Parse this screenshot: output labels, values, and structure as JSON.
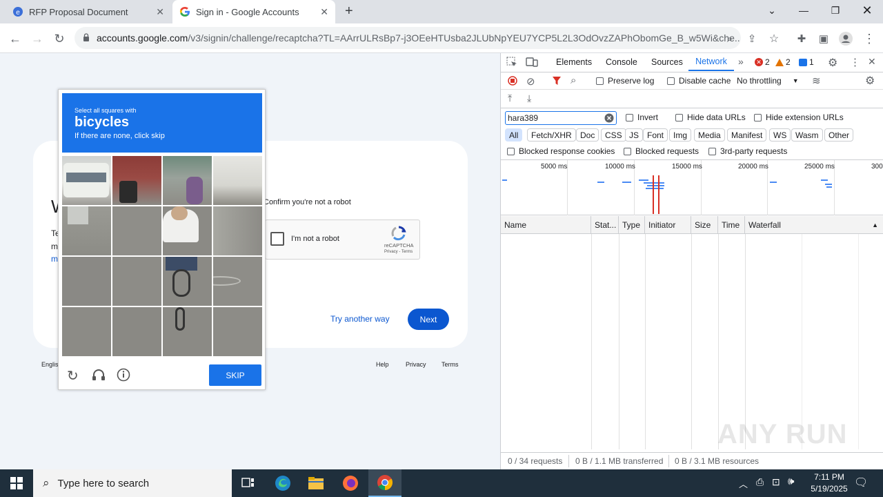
{
  "browser": {
    "tabs": [
      {
        "title": "RFP Proposal Document",
        "icon": "edge-doc-icon"
      },
      {
        "title": "Sign in - Google Accounts",
        "icon": "google-g-icon"
      }
    ],
    "url_host": "accounts.google.com",
    "url_path": "/v3/signin/challenge/recaptcha?TL=AArrULRsBp7-j3OEeHTUsba2JLUbNpYEU7YCP5L2L3OdOvzZAPhObomGe_B_w5Wi&che..."
  },
  "page": {
    "confirm_text": "Confirm you're not a robot",
    "recaptcha_label": "I'm not a robot",
    "recaptcha_brand": "reCAPTCHA",
    "recaptcha_links": "Privacy - Terms",
    "try_another": "Try another way",
    "next_label": "Next",
    "footer_lang": "Englis",
    "footer_help": "Help",
    "footer_privacy": "Privacy",
    "footer_terms": "Terms",
    "partial_letters": [
      "W",
      "Te",
      "m",
      "m"
    ]
  },
  "captcha": {
    "instruction_top": "Select all squares with",
    "target": "bicycles",
    "instruction_bottom": "If there are none, click skip",
    "skip_label": "SKIP"
  },
  "devtools": {
    "tabs": [
      "Elements",
      "Console",
      "Sources",
      "Network"
    ],
    "active_tab": "Network",
    "error_count": "2",
    "warning_count": "2",
    "info_count": "1",
    "preserve_log": "Preserve log",
    "disable_cache": "Disable cache",
    "throttling": "No throttling",
    "filter_value": "hara389",
    "invert": "Invert",
    "hide_data_urls": "Hide data URLs",
    "hide_ext_urls": "Hide extension URLs",
    "filters": [
      "All",
      "Fetch/XHR",
      "Doc",
      "CSS",
      "JS",
      "Font",
      "Img",
      "Media",
      "Manifest",
      "WS",
      "Wasm",
      "Other"
    ],
    "blocked_cookies": "Blocked response cookies",
    "blocked_requests": "Blocked requests",
    "third_party": "3rd-party requests",
    "ticks": [
      "5000 ms",
      "10000 ms",
      "15000 ms",
      "20000 ms",
      "25000 ms",
      "300"
    ],
    "columns": [
      "Name",
      "Stat...",
      "Type",
      "Initiator",
      "Size",
      "Time",
      "Waterfall"
    ],
    "status_requests": "0 / 34 requests",
    "status_transferred": "0 B / 1.1 MB transferred",
    "status_resources": "0 B / 3.1 MB resources"
  },
  "taskbar": {
    "search_placeholder": "Type here to search",
    "time": "7:11 PM",
    "date": "5/19/2025"
  },
  "watermark": "ANY RUN"
}
